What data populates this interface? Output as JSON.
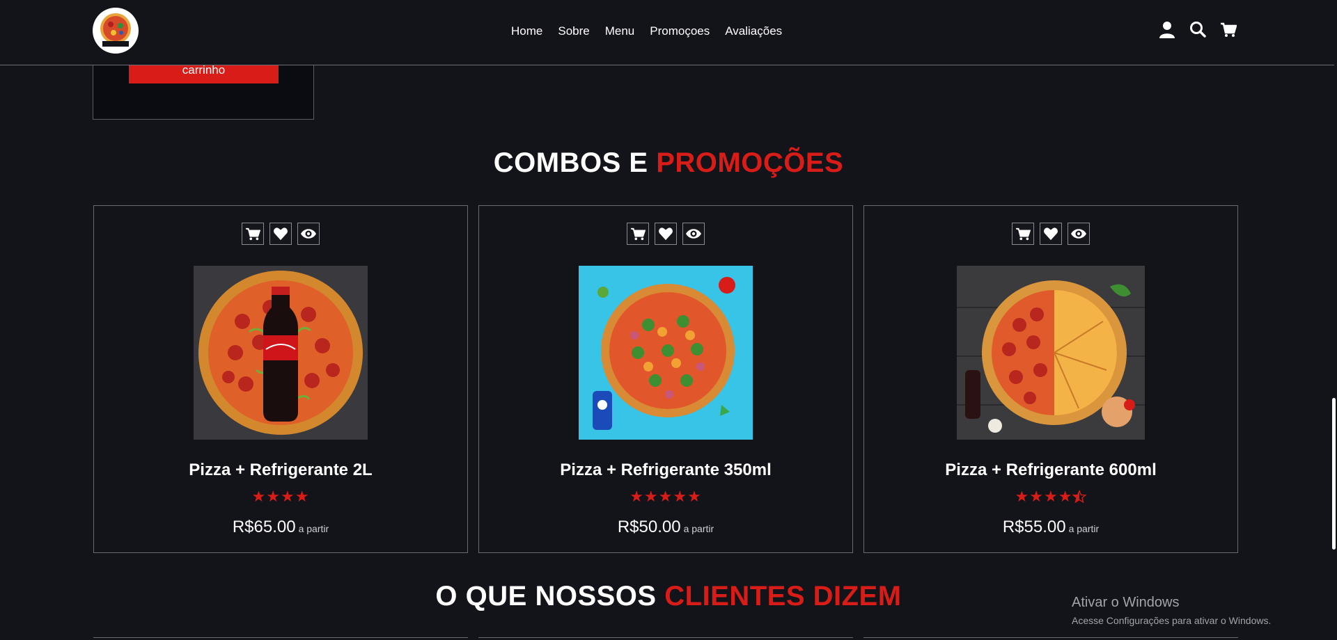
{
  "header": {
    "nav": [
      {
        "label": "Home"
      },
      {
        "label": "Sobre"
      },
      {
        "label": "Menu"
      },
      {
        "label": "Promoçoes"
      },
      {
        "label": "Avaliações"
      }
    ],
    "icons": [
      "user-icon",
      "search-icon",
      "cart-icon"
    ]
  },
  "previous_card": {
    "button_label": "carrinho"
  },
  "promotions": {
    "title_part1": "COMBOS E ",
    "title_part2": "PROMOÇÕES",
    "items": [
      {
        "name": "Pizza + Refrigerante 2L",
        "stars": "★★★★",
        "rating": 4,
        "price": "R$65.00",
        "price_note": "a partir"
      },
      {
        "name": "Pizza + Refrigerante 350ml",
        "stars": "★★★★★",
        "rating": 5,
        "price": "R$50.00",
        "price_note": "a partir"
      },
      {
        "name": "Pizza + Refrigerante 600ml",
        "stars": "★★★★",
        "rating": 4.5,
        "price": "R$55.00",
        "price_note": "a partir"
      }
    ]
  },
  "reviews": {
    "title_part1": "O QUE NOSSOS ",
    "title_part2": "CLIENTES DIZEM"
  },
  "windows_watermark": {
    "line1": "Ativar o Windows",
    "line2": "Acesse Configurações para ativar o Windows."
  },
  "colors": {
    "background": "#13131a",
    "accent": "#d81c17",
    "text": "#ffffff"
  }
}
